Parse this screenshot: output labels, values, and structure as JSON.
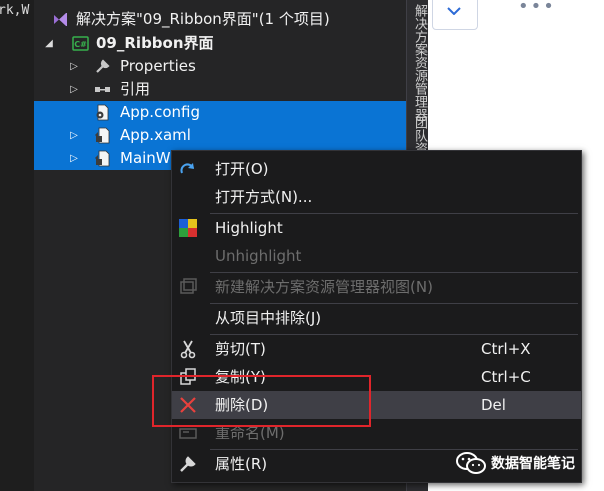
{
  "editor": {
    "code_fragment": "rk,W"
  },
  "solution_explorer": {
    "solution_label": "解决方案\"09_Ribbon界面\"(1 个项目)",
    "project_label": "09_Ribbon界面",
    "items": [
      {
        "label": "Properties"
      },
      {
        "label": "引用"
      },
      {
        "label": "App.config"
      },
      {
        "label": "App.xaml"
      },
      {
        "label": "MainW"
      }
    ]
  },
  "side_tabs": [
    {
      "label": "解决方案资源管理器"
    },
    {
      "label": "团队资源"
    }
  ],
  "context_menu": {
    "items": [
      {
        "label": "打开(O)",
        "shortcut": "",
        "icon": "open-arrow-icon"
      },
      {
        "label": "打开方式(N)...",
        "shortcut": "",
        "icon": ""
      },
      {
        "label": "Highlight",
        "shortcut": "",
        "icon": "highlight-color-icon"
      },
      {
        "label": "Unhighlight",
        "shortcut": "",
        "icon": ""
      },
      {
        "label": "新建解决方案资源管理器视图(N)",
        "shortcut": "",
        "icon": "new-view-icon"
      },
      {
        "label": "从项目中排除(J)",
        "shortcut": "",
        "icon": ""
      },
      {
        "label": "剪切(T)",
        "shortcut": "Ctrl+X",
        "icon": "scissors-icon"
      },
      {
        "label": "复制(Y)",
        "shortcut": "Ctrl+C",
        "icon": "copy-icon"
      },
      {
        "label": "删除(D)",
        "shortcut": "Del",
        "icon": "delete-x-icon"
      },
      {
        "label": "重命名(M)",
        "shortcut": "",
        "icon": "rename-icon"
      },
      {
        "label": "属性(R)",
        "shortcut": "",
        "icon": "wrench-icon"
      }
    ]
  },
  "watermark": {
    "text": "数据智能笔记"
  },
  "colors": {
    "selection": "#0a74d4",
    "highlight_box": "#e0252b",
    "delete_icon": "#e8413d",
    "menu_bg": "#1b1b1c"
  }
}
